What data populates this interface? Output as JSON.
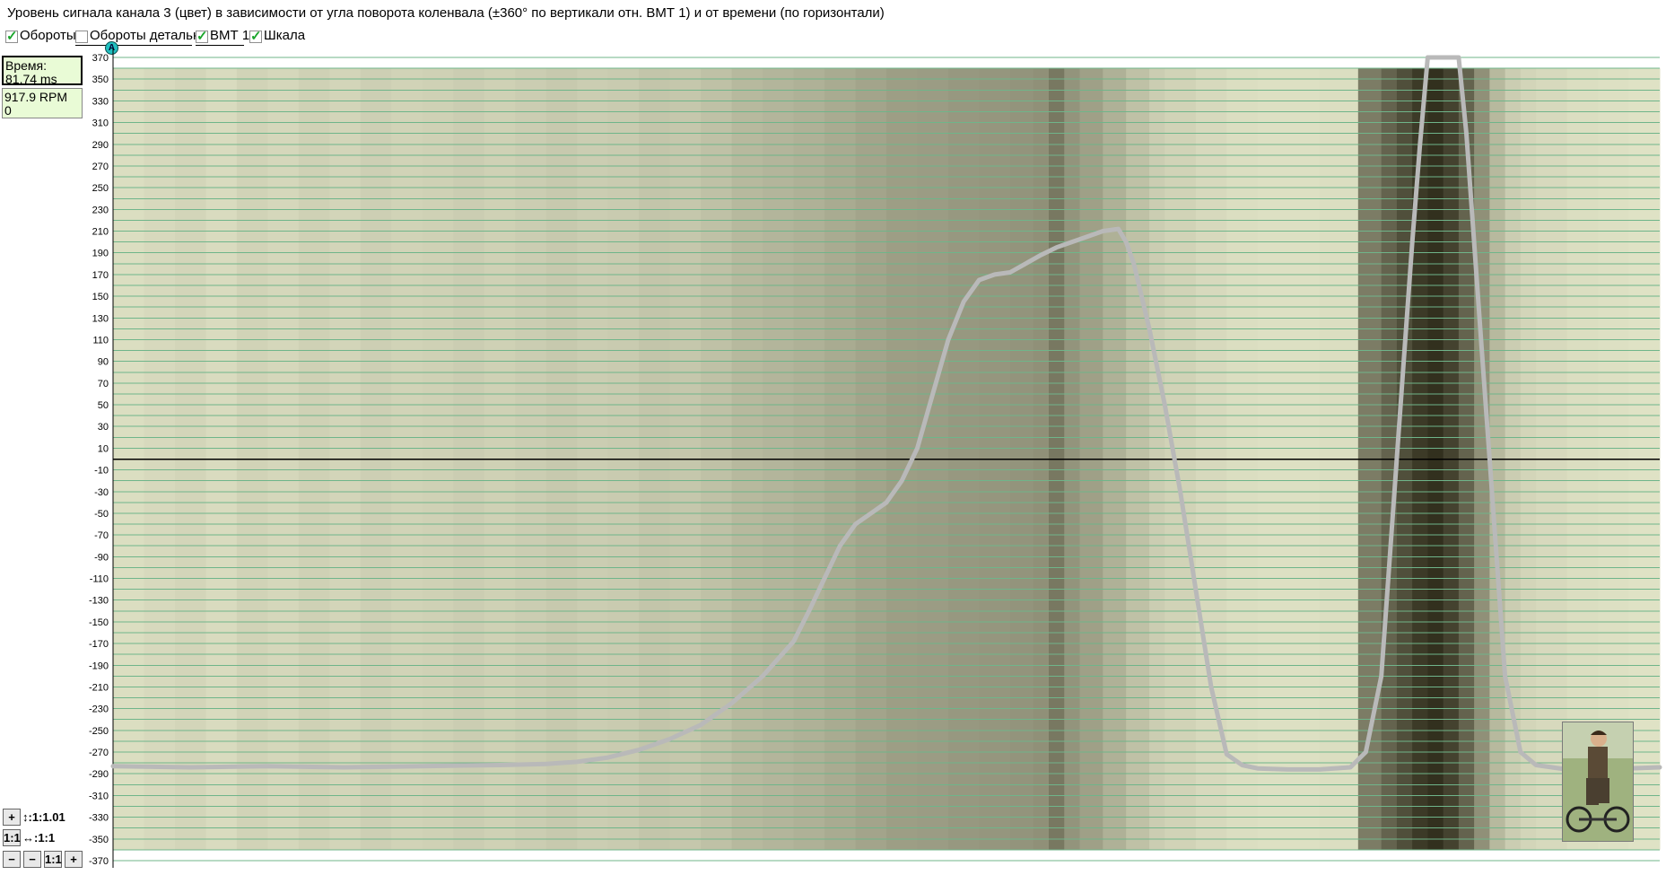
{
  "title": "Уровень сигнала канала 3 (цвет) в зависимости от угла поворота коленвала (±360° по вертикали отн. ВМТ 1) и от времени (по горизонтали)",
  "toolbar": {
    "checkboxes": [
      {
        "label": "Обороты",
        "checked": true
      },
      {
        "label": "Обороты детально",
        "checked": false
      },
      {
        "label": "ВМТ 1",
        "checked": true
      },
      {
        "label": "Шкала",
        "checked": true
      }
    ],
    "marker_label": "A"
  },
  "info": {
    "time_label": "Время:",
    "time_value": "81.74 ms",
    "rpm": "917.9 RPM",
    "rpm_sub": "0"
  },
  "zoom": {
    "vertical_label": "↕:1:1.01",
    "horizontal_label": "↔:1:1",
    "one_to_one": "1:1",
    "zoom_in": "+",
    "zoom_out": "−"
  },
  "colors": {
    "background": "#ffffff",
    "grid_line": "#6fb58a",
    "band_light": "#f3f6d8",
    "band_dark": "#2c2a18",
    "signal_trace": "#b9b9b9",
    "zero_line": "#000000"
  },
  "chart_data": {
    "type": "line",
    "title": "Уровень сигнала канала 3 (цвет) в зависимости от угла поворота коленвала (±360° по вертикали отн. ВМТ 1) и от времени (по горизонтали)",
    "xlabel": "",
    "ylabel": "",
    "ylim": [
      -375,
      375
    ],
    "y_ticks": [
      370,
      350,
      330,
      310,
      290,
      270,
      250,
      230,
      210,
      190,
      170,
      150,
      130,
      110,
      90,
      70,
      50,
      30,
      10,
      -10,
      -30,
      -50,
      -70,
      -90,
      -110,
      -130,
      -150,
      -170,
      -190,
      -210,
      -230,
      -250,
      -270,
      -290,
      -310,
      -330,
      -350,
      -370
    ],
    "x_range": [
      0,
      100
    ],
    "grid": true,
    "heatmap_bands": [
      [
        0,
        0.12
      ],
      [
        2,
        0.14
      ],
      [
        4,
        0.16
      ],
      [
        6,
        0.13
      ],
      [
        8,
        0.17
      ],
      [
        10,
        0.15
      ],
      [
        12,
        0.18
      ],
      [
        14,
        0.16
      ],
      [
        16,
        0.19
      ],
      [
        18,
        0.17
      ],
      [
        20,
        0.18
      ],
      [
        22,
        0.2
      ],
      [
        24,
        0.18
      ],
      [
        26,
        0.2
      ],
      [
        28,
        0.22
      ],
      [
        30,
        0.2
      ],
      [
        32,
        0.21
      ],
      [
        34,
        0.24
      ],
      [
        36,
        0.23
      ],
      [
        38,
        0.26
      ],
      [
        40,
        0.3
      ],
      [
        42,
        0.32
      ],
      [
        44,
        0.34
      ],
      [
        46,
        0.37
      ],
      [
        48,
        0.4
      ],
      [
        50,
        0.43
      ],
      [
        52,
        0.44
      ],
      [
        54,
        0.46
      ],
      [
        56,
        0.47
      ],
      [
        58,
        0.48
      ],
      [
        59.5,
        0.5
      ],
      [
        60.5,
        0.62
      ],
      [
        61.5,
        0.48
      ],
      [
        62.5,
        0.42
      ],
      [
        64,
        0.34
      ],
      [
        65.5,
        0.26
      ],
      [
        67,
        0.2
      ],
      [
        68,
        0.17
      ],
      [
        70,
        0.14
      ],
      [
        72,
        0.12
      ],
      [
        74,
        0.11
      ],
      [
        76,
        0.11
      ],
      [
        78,
        0.12
      ],
      [
        80.5,
        0.6
      ],
      [
        82,
        0.72
      ],
      [
        83,
        0.82
      ],
      [
        84,
        0.92
      ],
      [
        85,
        0.97
      ],
      [
        86,
        0.88
      ],
      [
        87,
        0.72
      ],
      [
        88,
        0.5
      ],
      [
        89,
        0.3
      ],
      [
        90,
        0.2
      ],
      [
        91,
        0.16
      ],
      [
        92,
        0.14
      ],
      [
        94,
        0.12
      ],
      [
        96,
        0.11
      ],
      [
        98,
        0.1
      ],
      [
        100,
        0.1
      ]
    ],
    "series": [
      {
        "values": [
          [
            0,
            -283
          ],
          [
            5,
            -284
          ],
          [
            10,
            -283
          ],
          [
            15,
            -284
          ],
          [
            20,
            -283
          ],
          [
            25,
            -282
          ],
          [
            28,
            -281
          ],
          [
            30,
            -279
          ],
          [
            32,
            -275
          ],
          [
            34,
            -268
          ],
          [
            36,
            -258
          ],
          [
            38,
            -245
          ],
          [
            40,
            -225
          ],
          [
            42,
            -200
          ],
          [
            44,
            -168
          ],
          [
            45,
            -140
          ],
          [
            46,
            -110
          ],
          [
            47,
            -80
          ],
          [
            48,
            -60
          ],
          [
            49,
            -50
          ],
          [
            50,
            -40
          ],
          [
            51,
            -20
          ],
          [
            52,
            10
          ],
          [
            53,
            60
          ],
          [
            54,
            110
          ],
          [
            55,
            145
          ],
          [
            56,
            165
          ],
          [
            57,
            170
          ],
          [
            58,
            172
          ],
          [
            59,
            180
          ],
          [
            60,
            188
          ],
          [
            61,
            195
          ],
          [
            62,
            200
          ],
          [
            63,
            205
          ],
          [
            64,
            210
          ],
          [
            65,
            212
          ],
          [
            65.5,
            200
          ],
          [
            66,
            180
          ],
          [
            67,
            120
          ],
          [
            68,
            50
          ],
          [
            69,
            -30
          ],
          [
            70,
            -120
          ],
          [
            71,
            -210
          ],
          [
            72,
            -272
          ],
          [
            73,
            -282
          ],
          [
            74,
            -285
          ],
          [
            76,
            -286
          ],
          [
            78,
            -286
          ],
          [
            80,
            -284
          ],
          [
            81,
            -270
          ],
          [
            82,
            -200
          ],
          [
            82.5,
            -100
          ],
          [
            83,
            0
          ],
          [
            83.5,
            100
          ],
          [
            84,
            200
          ],
          [
            84.5,
            290
          ],
          [
            85,
            370
          ],
          [
            87,
            370
          ],
          [
            87.5,
            300
          ],
          [
            88,
            200
          ],
          [
            88.5,
            100
          ],
          [
            89,
            0
          ],
          [
            89.5,
            -100
          ],
          [
            90,
            -200
          ],
          [
            91,
            -270
          ],
          [
            92,
            -282
          ],
          [
            94,
            -286
          ],
          [
            96,
            -286
          ],
          [
            98,
            -285
          ],
          [
            100,
            -284
          ]
        ]
      }
    ]
  }
}
